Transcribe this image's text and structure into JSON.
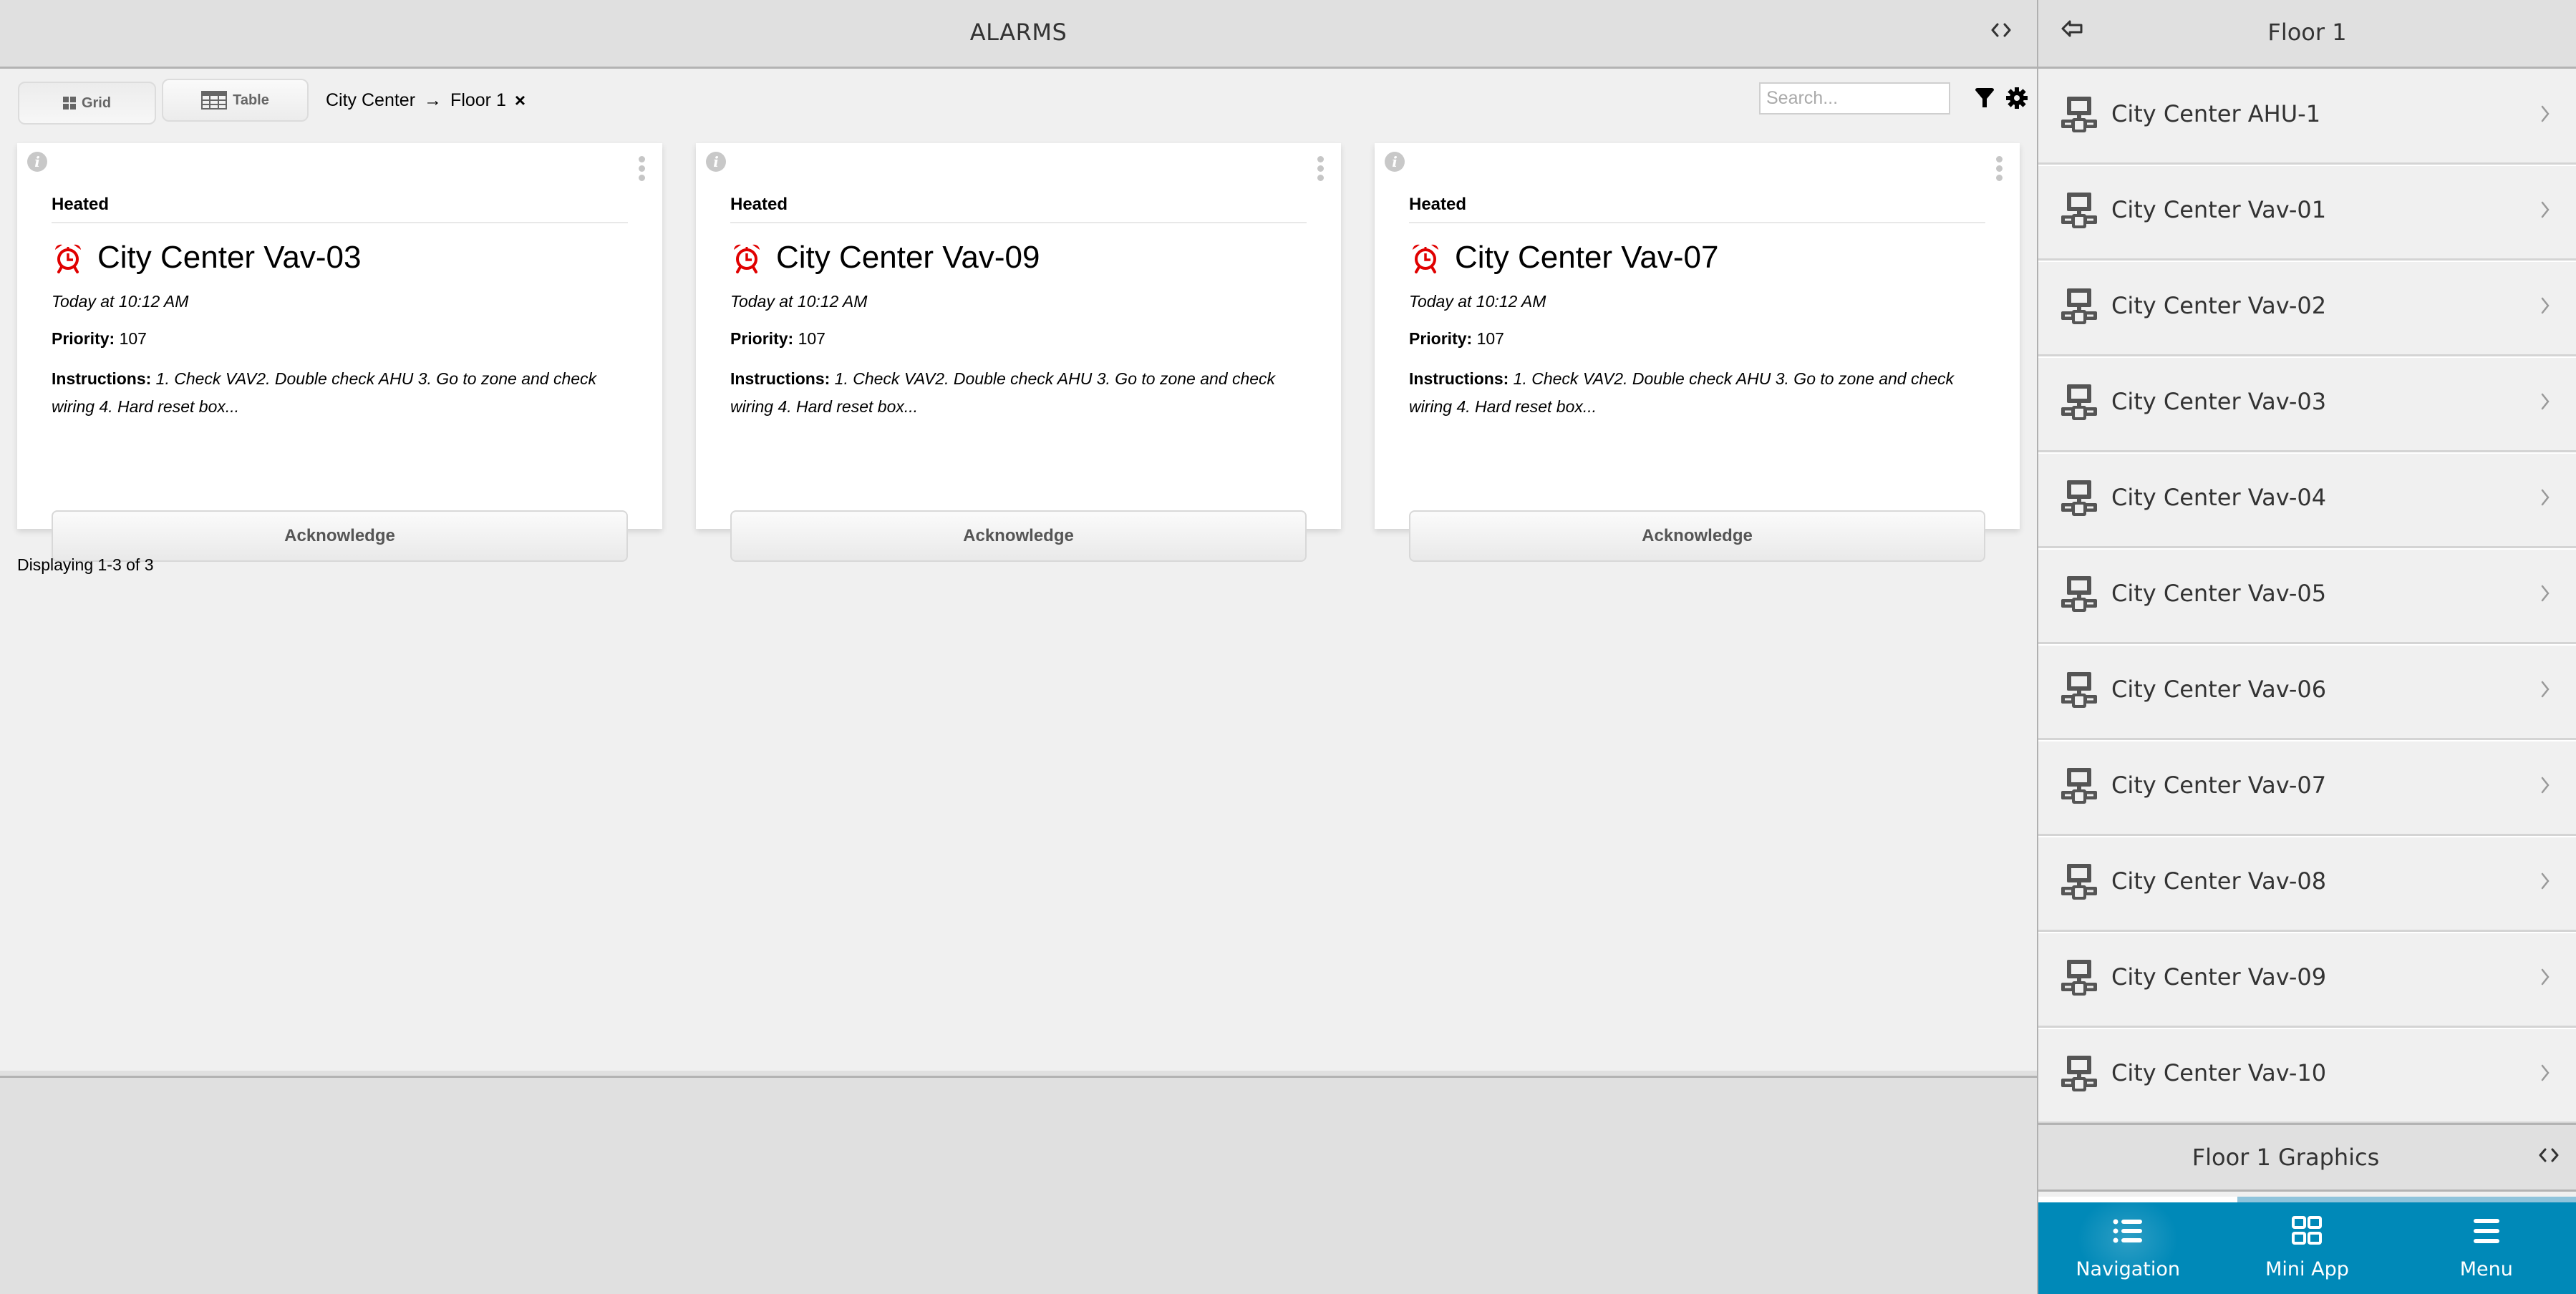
{
  "main": {
    "title": "ALARMS",
    "toolbar": {
      "grid_label": "Grid",
      "table_label": "Table",
      "active_view": "Grid",
      "breadcrumb": [
        "City Center",
        "Floor 1"
      ],
      "breadcrumb_separator": "→",
      "clear_label": "×",
      "search_placeholder": "Search...",
      "search_value": ""
    },
    "alarms": [
      {
        "category": "Heated",
        "name": "City Center Vav-03",
        "time": "Today at 10:12 AM",
        "priority_label": "Priority:",
        "priority": "107",
        "instructions_label": "Instructions:",
        "instructions": "1. Check VAV2. Double check AHU 3. Go to zone and check wiring 4. Hard reset box...",
        "action_label": "Acknowledge"
      },
      {
        "category": "Heated",
        "name": "City Center Vav-09",
        "time": "Today at 10:12 AM",
        "priority_label": "Priority:",
        "priority": "107",
        "instructions_label": "Instructions:",
        "instructions": "1. Check VAV2. Double check AHU 3. Go to zone and check wiring 4. Hard reset box...",
        "action_label": "Acknowledge"
      },
      {
        "category": "Heated",
        "name": "City Center Vav-07",
        "time": "Today at 10:12 AM",
        "priority_label": "Priority:",
        "priority": "107",
        "instructions_label": "Instructions:",
        "instructions": "1. Check VAV2. Double check AHU 3. Go to zone and check wiring 4. Hard reset box...",
        "action_label": "Acknowledge"
      }
    ],
    "pagination_text": "Displaying 1-3 of 3"
  },
  "panel": {
    "title": "Floor 1",
    "items": [
      {
        "label": "City Center AHU-1",
        "icon": "device-network-icon"
      },
      {
        "label": "City Center Vav-01",
        "icon": "device-network-icon"
      },
      {
        "label": "City Center Vav-02",
        "icon": "device-network-icon"
      },
      {
        "label": "City Center Vav-03",
        "icon": "device-network-icon"
      },
      {
        "label": "City Center Vav-04",
        "icon": "device-network-icon"
      },
      {
        "label": "City Center Vav-05",
        "icon": "device-network-icon"
      },
      {
        "label": "City Center Vav-06",
        "icon": "device-network-icon"
      },
      {
        "label": "City Center Vav-07",
        "icon": "device-network-icon"
      },
      {
        "label": "City Center Vav-08",
        "icon": "device-network-icon"
      },
      {
        "label": "City Center Vav-09",
        "icon": "device-network-icon"
      },
      {
        "label": "City Center Vav-10",
        "icon": "device-network-icon"
      }
    ],
    "graphics_title": "Floor 1 Graphics",
    "tab_indicator_fraction": 0.37,
    "bottom_nav": [
      {
        "label": "Navigation",
        "icon": "list-icon",
        "active": true
      },
      {
        "label": "Mini App",
        "icon": "grid-icon",
        "active": false
      },
      {
        "label": "Menu",
        "icon": "hamburger-icon",
        "active": false
      }
    ]
  },
  "colors": {
    "accent": "#0089b8",
    "alarm": "#e00000",
    "header_bg": "#e0e0e0",
    "content_bg": "#f0f0f0"
  }
}
